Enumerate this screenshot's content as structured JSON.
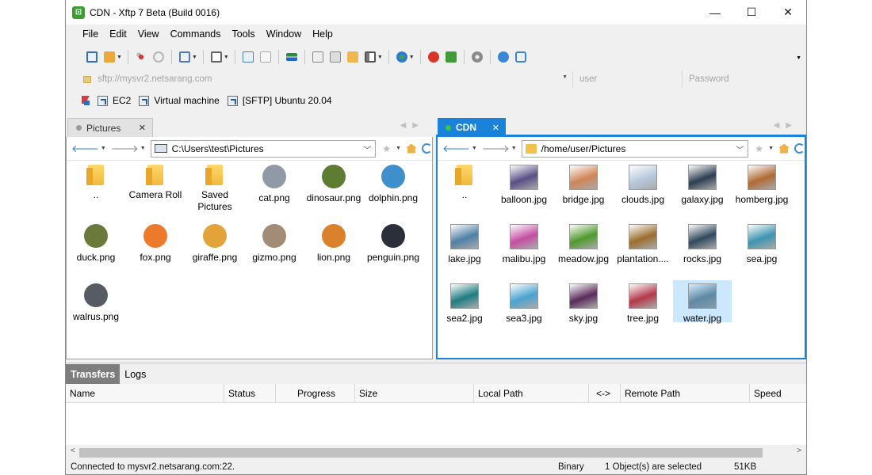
{
  "window": {
    "title": "CDN - Xftp 7 Beta (Build 0016)",
    "controls": [
      "—",
      "☐",
      "✕"
    ]
  },
  "menu": [
    "File",
    "Edit",
    "View",
    "Commands",
    "Tools",
    "Window",
    "Help"
  ],
  "address": {
    "url_placeholder": "sftp://mysvr2.netsarang.com",
    "user_placeholder": "user",
    "password_placeholder": "Password"
  },
  "links": [
    "EC2",
    "Virtual machine",
    "[SFTP] Ubuntu 20.04"
  ],
  "left_pane": {
    "tab_label": "Pictures",
    "path": "C:\\Users\\test\\Pictures",
    "items": [
      {
        "label": "..",
        "kind": "folder"
      },
      {
        "label": "Camera Roll",
        "kind": "folder"
      },
      {
        "label": "Saved Pictures",
        "kind": "folder"
      },
      {
        "label": "cat.png",
        "kind": "animal",
        "color": "#8f9aa6"
      },
      {
        "label": "dinosaur.png",
        "kind": "animal",
        "color": "#5f7d32"
      },
      {
        "label": "dolphin.png",
        "kind": "animal",
        "color": "#3f8fcc"
      },
      {
        "label": "duck.png",
        "kind": "animal",
        "color": "#6b7a3a"
      },
      {
        "label": "fox.png",
        "kind": "animal",
        "color": "#ec7a2a"
      },
      {
        "label": "giraffe.png",
        "kind": "animal",
        "color": "#e3a33b"
      },
      {
        "label": "gizmo.png",
        "kind": "animal",
        "color": "#a38c77"
      },
      {
        "label": "lion.png",
        "kind": "animal",
        "color": "#d9812b"
      },
      {
        "label": "penguin.png",
        "kind": "animal",
        "color": "#2b2f3a"
      },
      {
        "label": "walrus.png",
        "kind": "animal",
        "color": "#575b63"
      }
    ]
  },
  "right_pane": {
    "tab_label": "CDN",
    "path": "/home/user/Pictures",
    "items": [
      {
        "label": "..",
        "kind": "folder"
      },
      {
        "label": "balloon.jpg",
        "kind": "photo",
        "color": "#5a4f86"
      },
      {
        "label": "bridge.jpg",
        "kind": "photo",
        "color": "#d08557"
      },
      {
        "label": "clouds.jpg",
        "kind": "photo",
        "color": "#b7c9dd"
      },
      {
        "label": "galaxy.jpg",
        "kind": "photo",
        "color": "#2c3e52"
      },
      {
        "label": "homberg.jpg",
        "kind": "photo",
        "color": "#b06a35"
      },
      {
        "label": "lake.jpg",
        "kind": "photo",
        "color": "#4f7fa6"
      },
      {
        "label": "malibu.jpg",
        "kind": "photo",
        "color": "#c44ea2"
      },
      {
        "label": "meadow.jpg",
        "kind": "photo",
        "color": "#4f9a2c"
      },
      {
        "label": "plantation....",
        "kind": "photo",
        "color": "#9b6d2f"
      },
      {
        "label": "rocks.jpg",
        "kind": "photo",
        "color": "#30495e"
      },
      {
        "label": "sea.jpg",
        "kind": "photo",
        "color": "#3e94b0"
      },
      {
        "label": "sea2.jpg",
        "kind": "photo",
        "color": "#1f7c82"
      },
      {
        "label": "sea3.jpg",
        "kind": "photo",
        "color": "#4aa3cf"
      },
      {
        "label": "sky.jpg",
        "kind": "photo",
        "color": "#5a2b5a"
      },
      {
        "label": "tree.jpg",
        "kind": "photo",
        "color": "#b3394a"
      },
      {
        "label": "water.jpg",
        "kind": "photo",
        "color": "#5d8aa4",
        "selected": true
      }
    ]
  },
  "transfers": {
    "tabs": [
      "Transfers",
      "Logs"
    ],
    "columns": [
      "Name",
      "Status",
      "Progress",
      "Size",
      "Local Path",
      "<->",
      "Remote Path",
      "Speed"
    ]
  },
  "status": {
    "connection": "Connected to mysvr2.netsarang.com:22.",
    "mode": "Binary",
    "selection": "1 Object(s) are selected",
    "size": "51KB"
  }
}
